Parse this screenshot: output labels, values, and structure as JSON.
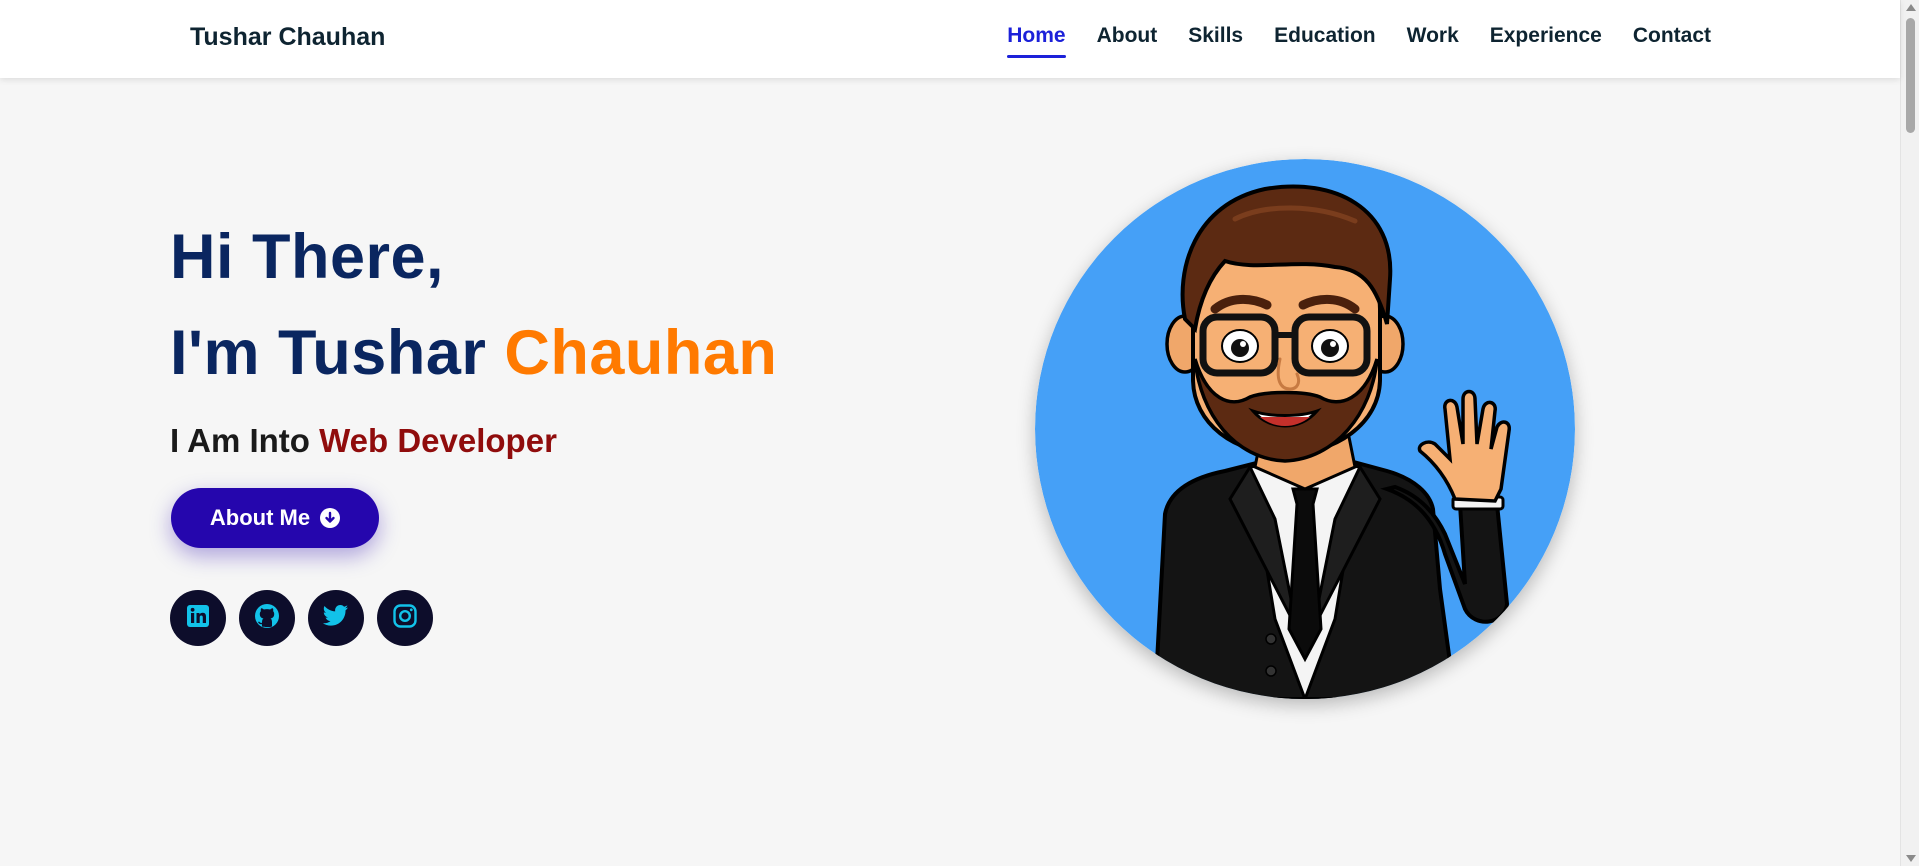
{
  "brand": "Tushar Chauhan",
  "nav": {
    "items": [
      "Home",
      "About",
      "Skills",
      "Education",
      "Work",
      "Experience",
      "Contact"
    ],
    "active": "Home"
  },
  "hero": {
    "greeting": "Hi There,",
    "name_prefix": "I'm Tushar ",
    "name_accent": "Chauhan",
    "into_prefix": "I Am Into ",
    "role": "Web Developer",
    "button_label": "About Me",
    "button_icon": "arrow-circle-down-icon"
  },
  "socials": [
    {
      "name": "linkedin-icon"
    },
    {
      "name": "github-icon"
    },
    {
      "name": "twitter-icon"
    },
    {
      "name": "instagram-icon"
    }
  ],
  "avatar": {
    "description_icon": "waving-avatar-illustration"
  },
  "colors": {
    "nav_active": "#1c21d9",
    "heading": "#0a2660",
    "accent": "#ff7a00",
    "role": "#900c0c",
    "button": "#2506ad",
    "social_bg": "#0d0d2b",
    "social_icon": "#12c2e9",
    "avatar_bg": "#45a0f7"
  }
}
